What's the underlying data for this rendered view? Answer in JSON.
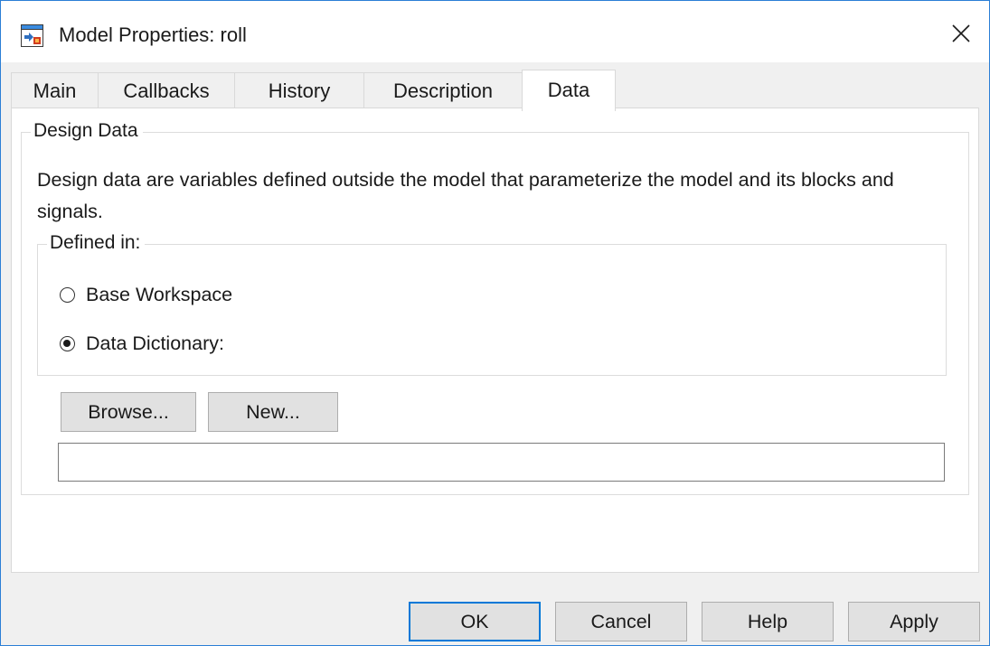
{
  "window": {
    "title": "Model Properties: roll",
    "close_glyph": "✕",
    "app_icon": "simulink-model-icon"
  },
  "tabs": [
    {
      "label": "Main",
      "active": false
    },
    {
      "label": "Callbacks",
      "active": false
    },
    {
      "label": "History",
      "active": false
    },
    {
      "label": "Description",
      "active": false
    },
    {
      "label": "Data",
      "active": true
    }
  ],
  "design_data": {
    "legend": "Design Data",
    "description": "Design data are variables defined outside the model that parameterize the model and its blocks and signals.",
    "defined_in": {
      "legend": "Defined in:",
      "options": [
        {
          "label": "Base Workspace",
          "selected": false
        },
        {
          "label": "Data Dictionary:",
          "selected": true
        }
      ]
    },
    "browse_label": "Browse...",
    "new_label": "New...",
    "dictionary_path": ""
  },
  "footer": {
    "ok_label": "OK",
    "cancel_label": "Cancel",
    "help_label": "Help",
    "apply_label": "Apply"
  },
  "colors": {
    "window_border": "#2b7fd6",
    "default_button_border": "#0078d7",
    "dialog_background": "#f0f0f0"
  }
}
